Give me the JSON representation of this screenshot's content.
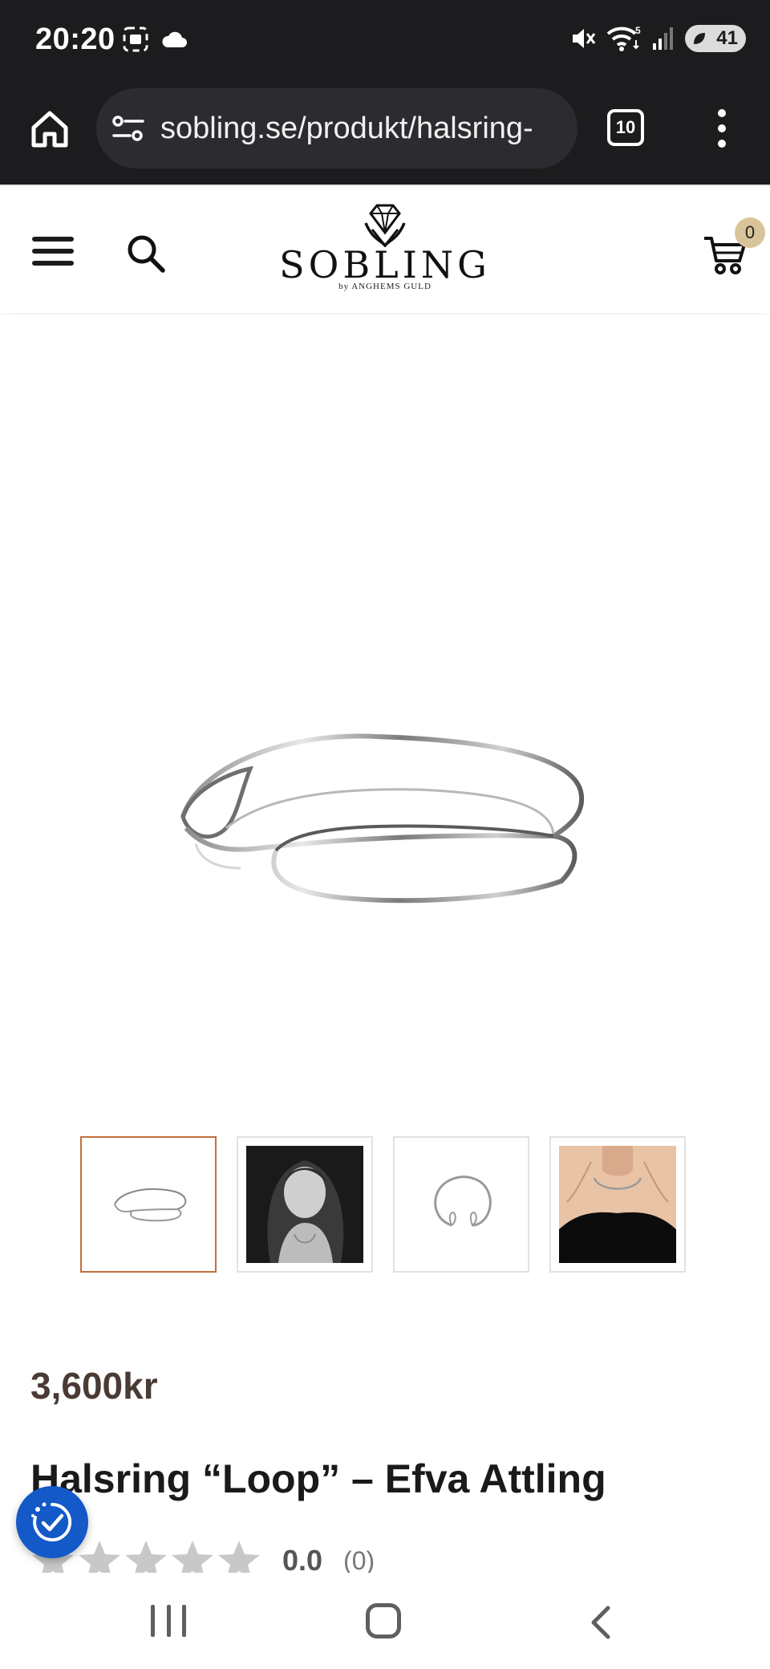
{
  "status_bar": {
    "time": "20:20",
    "battery_level": "41",
    "signal_label": "5"
  },
  "browser": {
    "url": "sobling.se/produkt/halsring-",
    "tab_count": "10"
  },
  "site": {
    "logo_text": "SOBLING",
    "logo_subtext": "by ANGHEMS GULD",
    "cart_count": "0"
  },
  "product": {
    "price": "3,600kr",
    "title": "Halsring “Loop” – Efva Attling",
    "rating_value": "0.0",
    "rating_count": "(0)",
    "stars_filled": 0,
    "stars_total": 5,
    "thumbnails": [
      {
        "name": "necklace-side-view",
        "active": true
      },
      {
        "name": "model-portrait-bw",
        "active": false
      },
      {
        "name": "necklace-top-view",
        "active": false
      },
      {
        "name": "necklace-worn",
        "active": false
      }
    ]
  },
  "colors": {
    "price": "#4a3b34",
    "active_thumb_border": "#c0703a",
    "cart_badge": "#d9c49a",
    "accessibility_button": "#1359c8"
  }
}
